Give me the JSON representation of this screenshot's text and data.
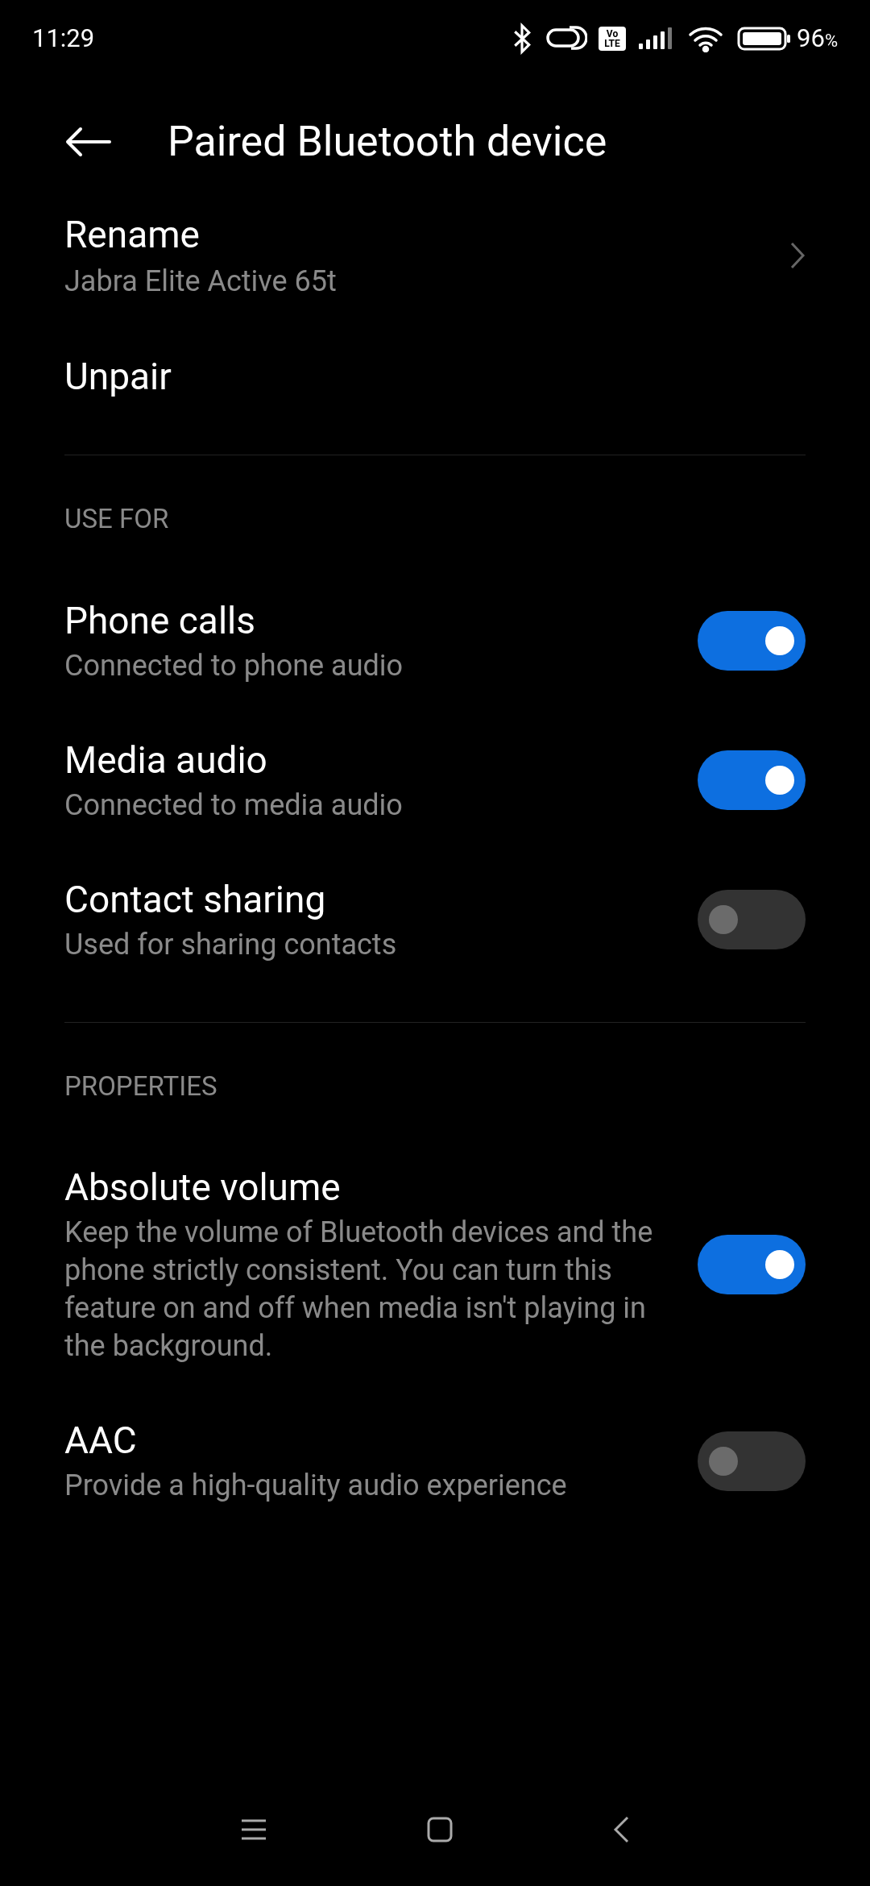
{
  "status_bar": {
    "time": "11:29",
    "volte": {
      "top": "Vo",
      "bottom": "LTE"
    },
    "battery": "96",
    "battery_unit": "%"
  },
  "header": {
    "title": "Paired Bluetooth device"
  },
  "device": [
    {
      "kind": "link",
      "title": "Rename",
      "subtitle": "Jabra Elite Active 65t"
    },
    {
      "kind": "action",
      "title": "Unpair"
    }
  ],
  "sections": [
    {
      "header": "USE FOR",
      "items": [
        {
          "title": "Phone calls",
          "subtitle": "Connected to phone audio",
          "on": true
        },
        {
          "title": "Media audio",
          "subtitle": "Connected to media audio",
          "on": true
        },
        {
          "title": "Contact sharing",
          "subtitle": "Used for sharing contacts",
          "on": false
        }
      ]
    },
    {
      "header": "PROPERTIES",
      "items": [
        {
          "title": "Absolute volume",
          "subtitle": "Keep the volume of Bluetooth devices and the phone strictly consistent. You can turn this feature on and off when media isn't playing in the background.",
          "on": true
        },
        {
          "title": "AAC",
          "subtitle": "Provide a high-quality audio experience",
          "on": false
        }
      ]
    }
  ]
}
